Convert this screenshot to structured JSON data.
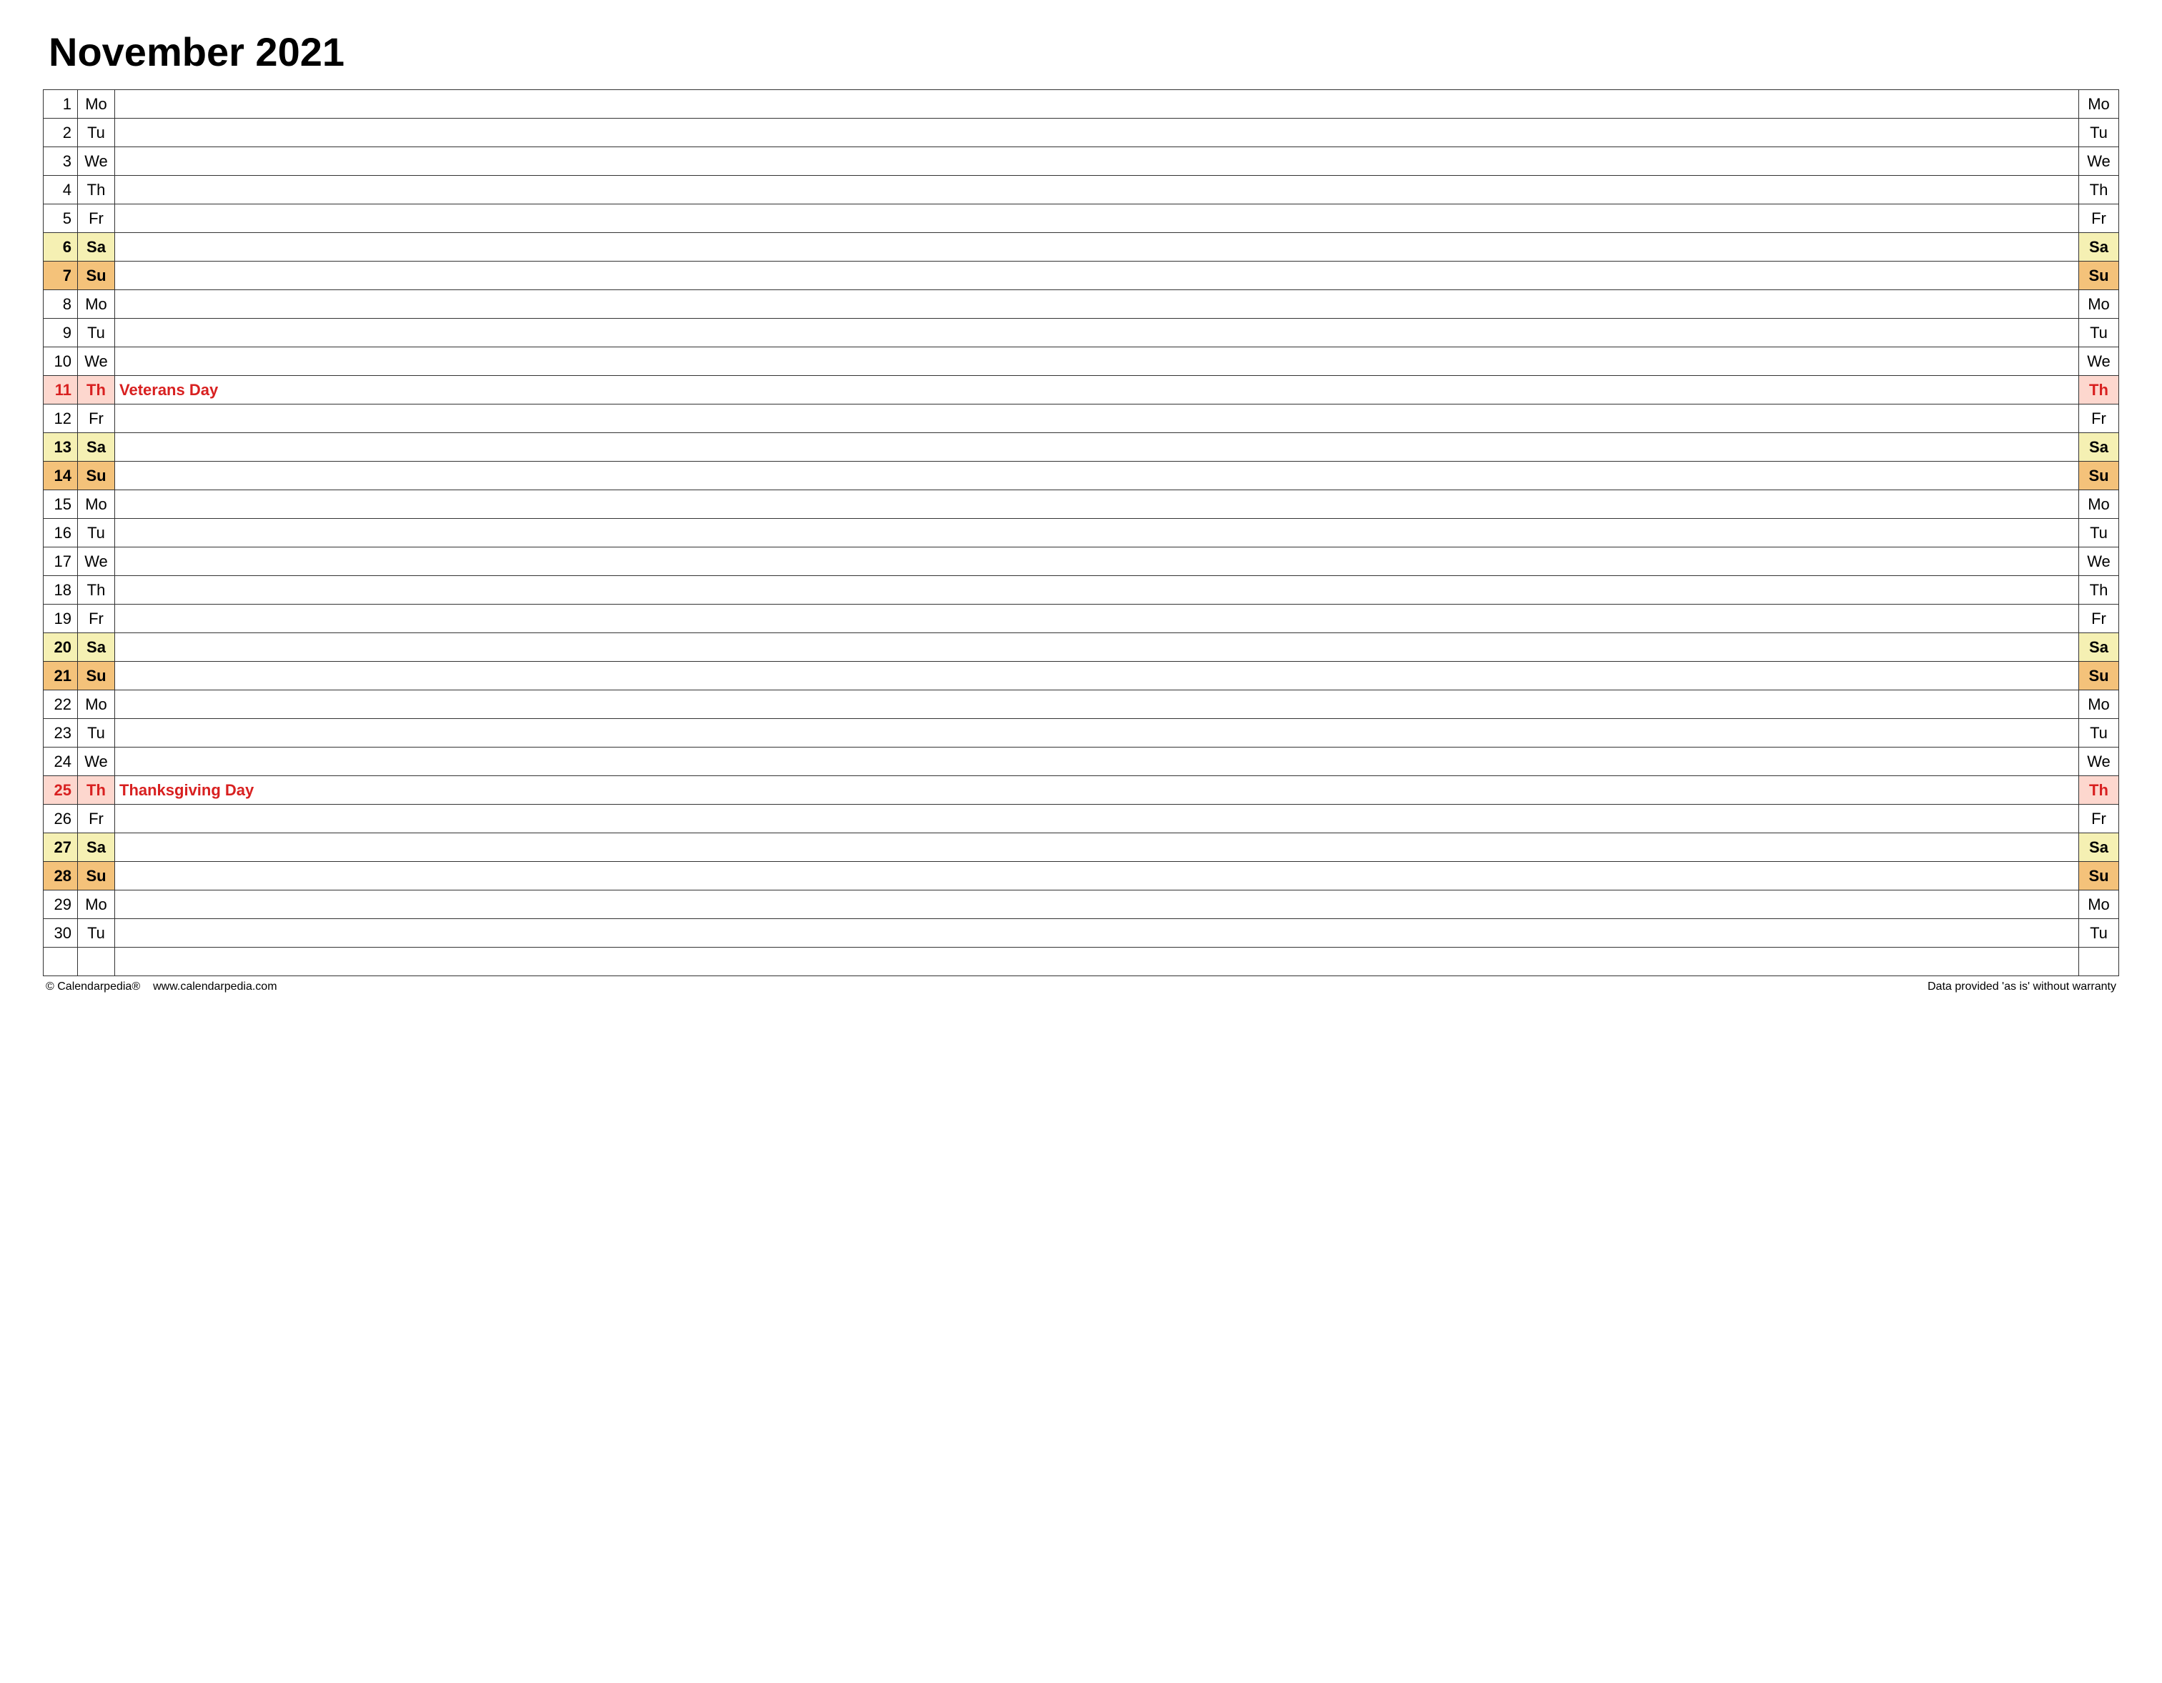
{
  "title": "November 2021",
  "footer": {
    "copyright": "© Calendarpedia®",
    "url": "www.calendarpedia.com",
    "disclaimer": "Data provided 'as is' without warranty"
  },
  "days": [
    {
      "num": "1",
      "dow": "Mo",
      "note": "",
      "type": "weekday"
    },
    {
      "num": "2",
      "dow": "Tu",
      "note": "",
      "type": "weekday"
    },
    {
      "num": "3",
      "dow": "We",
      "note": "",
      "type": "weekday"
    },
    {
      "num": "4",
      "dow": "Th",
      "note": "",
      "type": "weekday"
    },
    {
      "num": "5",
      "dow": "Fr",
      "note": "",
      "type": "weekday"
    },
    {
      "num": "6",
      "dow": "Sa",
      "note": "",
      "type": "sat"
    },
    {
      "num": "7",
      "dow": "Su",
      "note": "",
      "type": "sun"
    },
    {
      "num": "8",
      "dow": "Mo",
      "note": "",
      "type": "weekday"
    },
    {
      "num": "9",
      "dow": "Tu",
      "note": "",
      "type": "weekday"
    },
    {
      "num": "10",
      "dow": "We",
      "note": "",
      "type": "weekday"
    },
    {
      "num": "11",
      "dow": "Th",
      "note": "Veterans Day",
      "type": "holiday"
    },
    {
      "num": "12",
      "dow": "Fr",
      "note": "",
      "type": "weekday"
    },
    {
      "num": "13",
      "dow": "Sa",
      "note": "",
      "type": "sat"
    },
    {
      "num": "14",
      "dow": "Su",
      "note": "",
      "type": "sun"
    },
    {
      "num": "15",
      "dow": "Mo",
      "note": "",
      "type": "weekday"
    },
    {
      "num": "16",
      "dow": "Tu",
      "note": "",
      "type": "weekday"
    },
    {
      "num": "17",
      "dow": "We",
      "note": "",
      "type": "weekday"
    },
    {
      "num": "18",
      "dow": "Th",
      "note": "",
      "type": "weekday"
    },
    {
      "num": "19",
      "dow": "Fr",
      "note": "",
      "type": "weekday"
    },
    {
      "num": "20",
      "dow": "Sa",
      "note": "",
      "type": "sat"
    },
    {
      "num": "21",
      "dow": "Su",
      "note": "",
      "type": "sun"
    },
    {
      "num": "22",
      "dow": "Mo",
      "note": "",
      "type": "weekday"
    },
    {
      "num": "23",
      "dow": "Tu",
      "note": "",
      "type": "weekday"
    },
    {
      "num": "24",
      "dow": "We",
      "note": "",
      "type": "weekday"
    },
    {
      "num": "25",
      "dow": "Th",
      "note": "Thanksgiving Day",
      "type": "holiday"
    },
    {
      "num": "26",
      "dow": "Fr",
      "note": "",
      "type": "weekday"
    },
    {
      "num": "27",
      "dow": "Sa",
      "note": "",
      "type": "sat"
    },
    {
      "num": "28",
      "dow": "Su",
      "note": "",
      "type": "sun"
    },
    {
      "num": "29",
      "dow": "Mo",
      "note": "",
      "type": "weekday"
    },
    {
      "num": "30",
      "dow": "Tu",
      "note": "",
      "type": "weekday"
    },
    {
      "num": "",
      "dow": "",
      "note": "",
      "type": "blank"
    }
  ]
}
